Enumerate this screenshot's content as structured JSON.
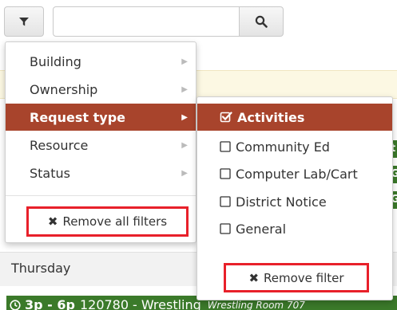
{
  "toolbar": {
    "filter_icon": "filter-icon",
    "search_placeholder": "",
    "search_icon": "search-icon"
  },
  "filter_menu": {
    "items": [
      {
        "label": "Building",
        "arrow": "▶"
      },
      {
        "label": "Ownership",
        "arrow": "▶"
      },
      {
        "label": "Request type",
        "arrow": "▶",
        "active": true
      },
      {
        "label": "Resource",
        "arrow": "▶"
      },
      {
        "label": "Status",
        "arrow": "▶"
      }
    ],
    "remove_all_label": "Remove all filters"
  },
  "request_type_submenu": {
    "options": [
      {
        "label": "Activities",
        "checked": true
      },
      {
        "label": "Community Ed",
        "checked": false
      },
      {
        "label": "Computer Lab/Cart",
        "checked": false
      },
      {
        "label": "District Notice",
        "checked": false
      },
      {
        "label": "General",
        "checked": false
      }
    ],
    "remove_filter_label": "Remove filter"
  },
  "calendar": {
    "day_label": "Thursday",
    "event": {
      "time": "3p - 6p",
      "id": "120780",
      "title": "Wrestling",
      "room": "Wrestling Room 707"
    },
    "side_chips": [
      "t",
      "G",
      "G"
    ]
  },
  "colors": {
    "accent": "#a8442c",
    "highlight_box": "#e8202a",
    "event_green": "#3b7a2a",
    "band_cream": "#fcf8e3"
  }
}
